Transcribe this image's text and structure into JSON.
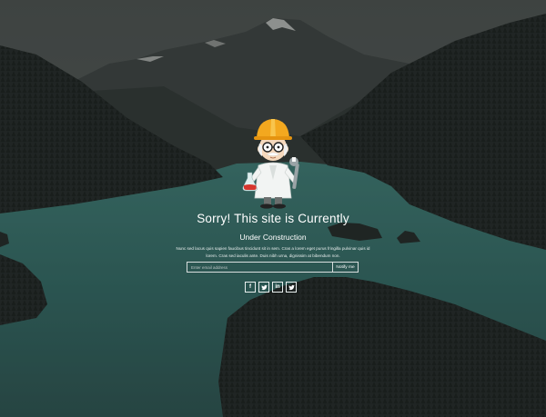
{
  "colors": {
    "lake": "#2f6662",
    "overlay": "#1f2625",
    "text": "#ffffff",
    "hat": "#f3a81f"
  },
  "heading": {
    "title": "Sorry! This site is Currently",
    "subtitle": "Under Construction"
  },
  "description": "Nunc sed lacus quis sapien faucibus tincidunt sit in sem. Cras a lorem eget purus fringilla pulvinar quis id lorem. Cras sed iaculis ante. Duis nibh urna, dignissim at bibendum non.",
  "subscribe": {
    "placeholder": "Enter email address",
    "button_label": "Notify me"
  },
  "social": [
    {
      "name": "facebook-icon",
      "glyph": "f"
    },
    {
      "name": "twitter-icon",
      "glyph": ""
    },
    {
      "name": "linkedin-icon",
      "glyph": "in"
    },
    {
      "name": "twitter-icon",
      "glyph": ""
    }
  ]
}
